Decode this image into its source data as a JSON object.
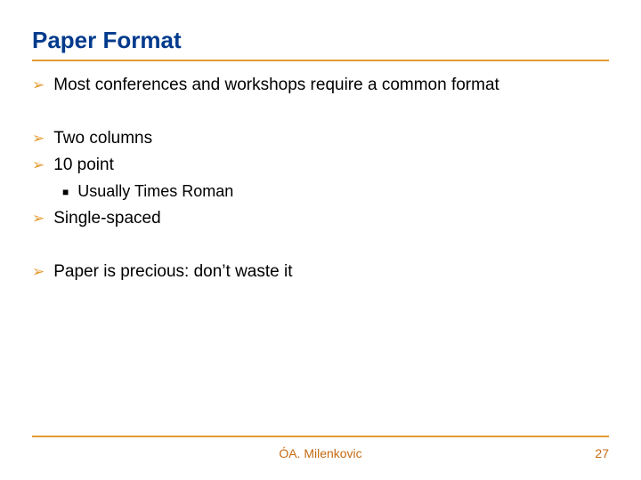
{
  "title": "Paper Format",
  "bullets": {
    "b0": "Most conferences and workshops require a common format",
    "b1": "Two columns",
    "b2": "10 point",
    "b2_0": "Usually Times Roman",
    "b3": "Single-spaced",
    "b4": "Paper is precious: don’t waste it"
  },
  "footer": {
    "author": "ÓA. Milenkovic",
    "page": "27"
  }
}
